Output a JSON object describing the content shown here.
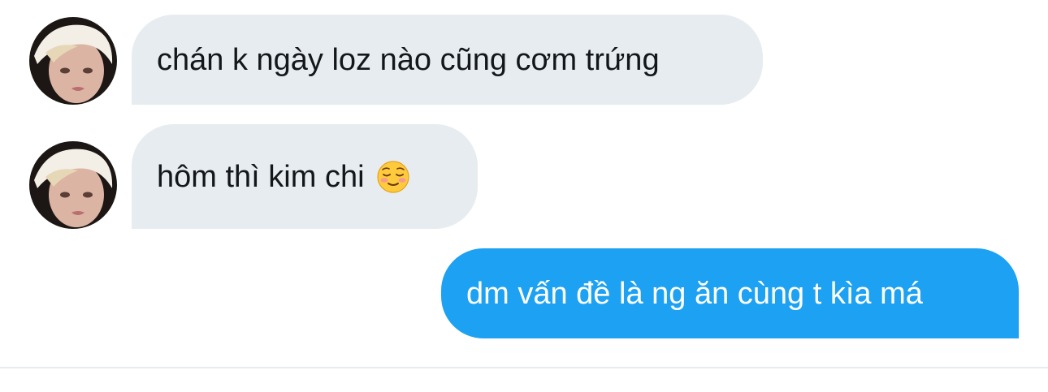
{
  "messages": [
    {
      "direction": "incoming",
      "text": "chán k ngày loz nào cũng cơm trứng"
    },
    {
      "direction": "incoming",
      "text": "hôm thì kim chi",
      "emoji": "relieved-face-emoji"
    },
    {
      "direction": "outgoing",
      "text": "dm vấn đề là ng ăn cùng t kìa má"
    }
  ],
  "colors": {
    "incoming_bubble": "#e6ecf0",
    "incoming_text": "#14171a",
    "outgoing_bubble": "#1da1f2",
    "outgoing_text": "#ffffff"
  }
}
